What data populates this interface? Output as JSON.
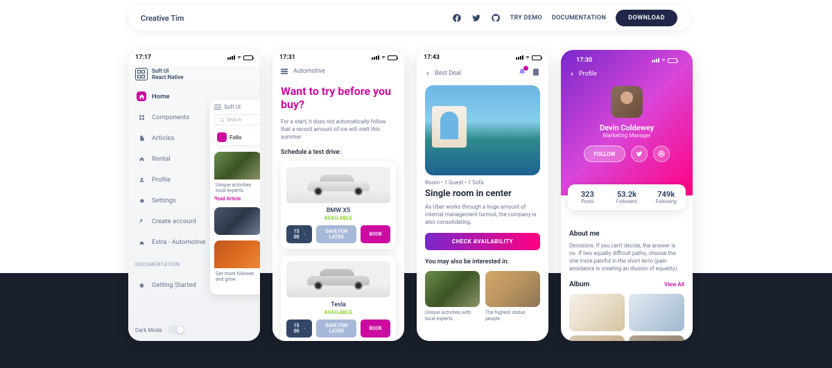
{
  "topbar": {
    "brand": "Creative Tim",
    "try_demo": "TRY DEMO",
    "documentation": "DOCUMENTATION",
    "download": "DOWNLOAD"
  },
  "phone1": {
    "time": "17:17",
    "logo_line1": "Soft UI",
    "logo_line2": "React Native",
    "menu": {
      "home": "Home",
      "components": "Components",
      "articles": "Articles",
      "rental": "Rental",
      "profile": "Profile",
      "settings": "Settings",
      "create_account": "Create account",
      "extra": "Extra - Automotive"
    },
    "doc_section": "DOCUMENTATION",
    "getting_started": "Getting Started",
    "dark_mode": "Dark Mode",
    "float": {
      "menu_label": "Soft UI",
      "search_placeholder": "Search",
      "follow": "Follo",
      "card1_text": "Unique activities local experts.",
      "card1_link": "Read Article",
      "card2_text": "Get more follower and grow."
    }
  },
  "phone2": {
    "time": "17:31",
    "header": "Automotive",
    "title": "Want to try before you buy?",
    "subtitle": "For a start, it does not automatically follow that a record amount of ice will melt this summer.",
    "schedule": "Schedule a test drive:",
    "car1": {
      "name": "BMW X5",
      "status": "AVAILABLE"
    },
    "car2": {
      "name": "Tesla",
      "status": "AVAILABLE"
    },
    "time_opt": "15 00",
    "later": "SAVE FOR LATER",
    "book": "BOOK"
  },
  "phone3": {
    "time": "17:43",
    "back": "Best Deal",
    "room_meta": "Room • 1 Guest • 1 Sofa",
    "room_title": "Single room in center",
    "room_desc": "As Uber works through a huge amount of internal management turmoil, the company is also consolidating.",
    "check": "CHECK AVAILABILITY",
    "interested": "You may also be interested in:",
    "card1": "Unique activities with local experts.",
    "card2": "The highest status people."
  },
  "phone4": {
    "time": "17:30",
    "back": "Profile",
    "name": "Devin Coldewey",
    "role": "Marketing Manager",
    "follow": "FOLLOW",
    "stats": [
      {
        "num": "323",
        "label": "Posts"
      },
      {
        "num": "53.2k",
        "label": "Followers"
      },
      {
        "num": "749k",
        "label": "Following"
      }
    ],
    "about_title": "About me",
    "about_text": "Decisions: If you can't decide, the answer is no. If two equally difficult paths, choose the one more painful in the short term (pain avoidance is creating an illusion of equality).",
    "album": "Album",
    "view_all": "View All"
  }
}
